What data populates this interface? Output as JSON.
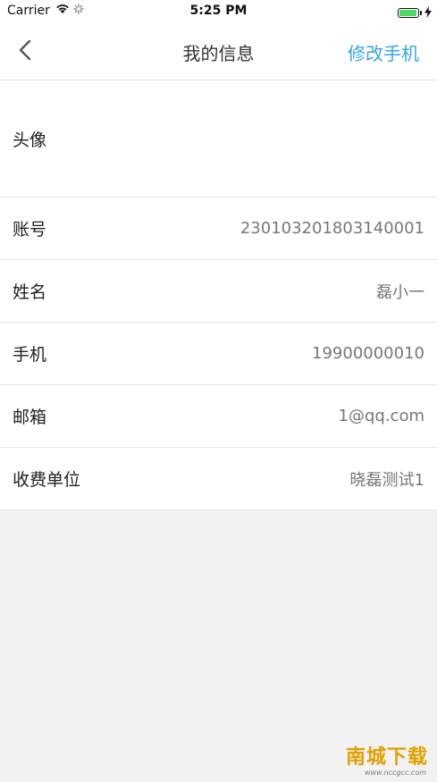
{
  "status_bar": {
    "carrier": "Carrier",
    "time": "5:25 PM",
    "battery_level": 1.0,
    "battery_color": "#4cd964"
  },
  "nav": {
    "back_icon": "chevron-left-icon",
    "title": "我的信息",
    "action_label": "修改手机",
    "action_color": "#3aa3e3"
  },
  "profile": {
    "rows": [
      {
        "label": "头像",
        "value": ""
      },
      {
        "label": "账号",
        "value": "230103201803140001"
      },
      {
        "label": "姓名",
        "value": "磊小一"
      },
      {
        "label": "手机",
        "value": "19900000010"
      },
      {
        "label": "邮箱",
        "value": "1@qq.com"
      },
      {
        "label": "收费单位",
        "value": "晓磊测试1"
      }
    ]
  },
  "watermark": {
    "text": "南城下载",
    "url": "www.nccgcc.com"
  }
}
